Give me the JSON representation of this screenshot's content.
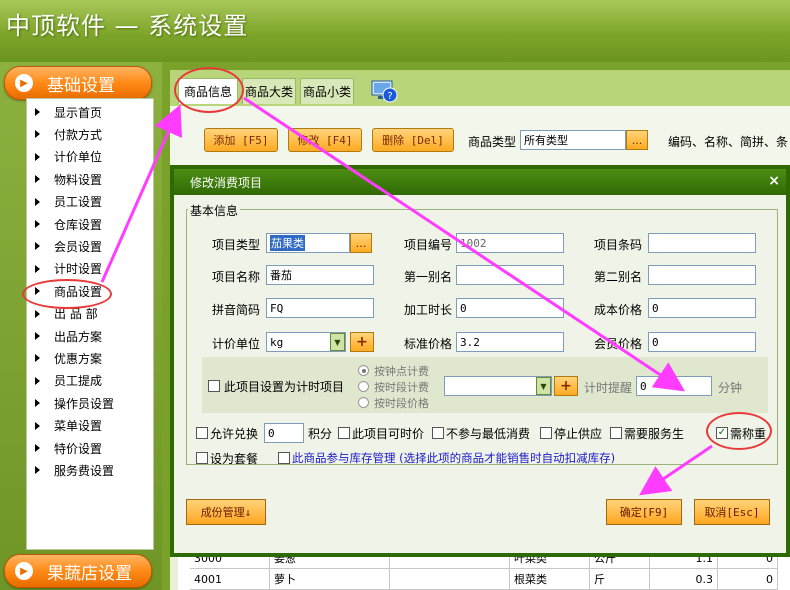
{
  "window": {
    "title": "中顶软件 — 系统设置"
  },
  "sidebar": {
    "section_top": "基础设置",
    "section_bottom": "果蔬店设置",
    "items": [
      "显示首页",
      "付款方式",
      "计价单位",
      "物料设置",
      "员工设置",
      "仓库设置",
      "会员设置",
      "计时设置",
      "商品设置",
      "出 品 部",
      "出品方案",
      "优惠方案",
      "员工提成",
      "操作员设置",
      "菜单设置",
      "特价设置",
      "服务费设置"
    ]
  },
  "tabs": [
    "商品信息",
    "商品大类",
    "商品小类"
  ],
  "toolbar": {
    "add": "添加 [F5]",
    "edit": "修改 [F4]",
    "delete": "删除 [Del]",
    "type_label": "商品类型",
    "type_value": "所有类型",
    "dots": "...",
    "search_hint": "编码、名称、简拼、条码"
  },
  "grid": {
    "rows": [
      [
        "3000",
        "姜葱",
        "",
        "叶菜类",
        "公斤",
        "1.1",
        "0"
      ],
      [
        "4001",
        "萝卜",
        "",
        "根菜类",
        "斤",
        "0.3",
        "0"
      ]
    ]
  },
  "dialog": {
    "title": "修改消费项目",
    "close": "×",
    "group_title": "基本信息",
    "labels": {
      "item_type": "项目类型",
      "item_code": "项目编号",
      "barcode": "项目条码",
      "item_name": "项目名称",
      "alias1": "第一别名",
      "alias2": "第二别名",
      "pinyin": "拼音简码",
      "process_time": "加工时长",
      "cost_price": "成本价格",
      "unit": "计价单位",
      "std_price": "标准价格",
      "member_price": "会员价格"
    },
    "values": {
      "item_type": "茄果类",
      "item_code": "1002",
      "barcode": "",
      "item_name": "番茄",
      "alias1": "",
      "alias2": "",
      "pinyin": "FQ",
      "process_time": "0",
      "cost_price": "0",
      "unit": "kg",
      "std_price": "3.2",
      "member_price": "0"
    },
    "plus": "+",
    "timed": {
      "check_label": "此项目设置为计时项目",
      "radio1": "按钟点计费",
      "radio2": "按时段计费",
      "radio3": "按时段价格",
      "reminder_label": "计时提醒",
      "reminder_value": "0",
      "minutes": "分钟"
    },
    "options": {
      "allow_exchange": "允许兑换",
      "points_value": "0",
      "points": "积分",
      "time_price": "此项目可时价",
      "no_min": "不参与最低消费",
      "stop_supply": "停止供应",
      "need_service": "需要服务生",
      "need_weigh": "需称重",
      "set_meal": "设为套餐",
      "stock_mgmt": "此商品参与库存管理 (选择此项的商品才能销售时自动扣减库存)"
    },
    "check_mark": "✓",
    "footer": {
      "cost_mgmt": "成份管理↓",
      "ok": "确定[F9]",
      "cancel": "取消[Esc]"
    }
  },
  "colors": {
    "accent_orange": "#ff8a16",
    "frame_green": "#2e6a00",
    "annotation_red": "#e83a3a",
    "arrow_magenta": "#ff3cff",
    "link_blue": "#1a1acc"
  }
}
